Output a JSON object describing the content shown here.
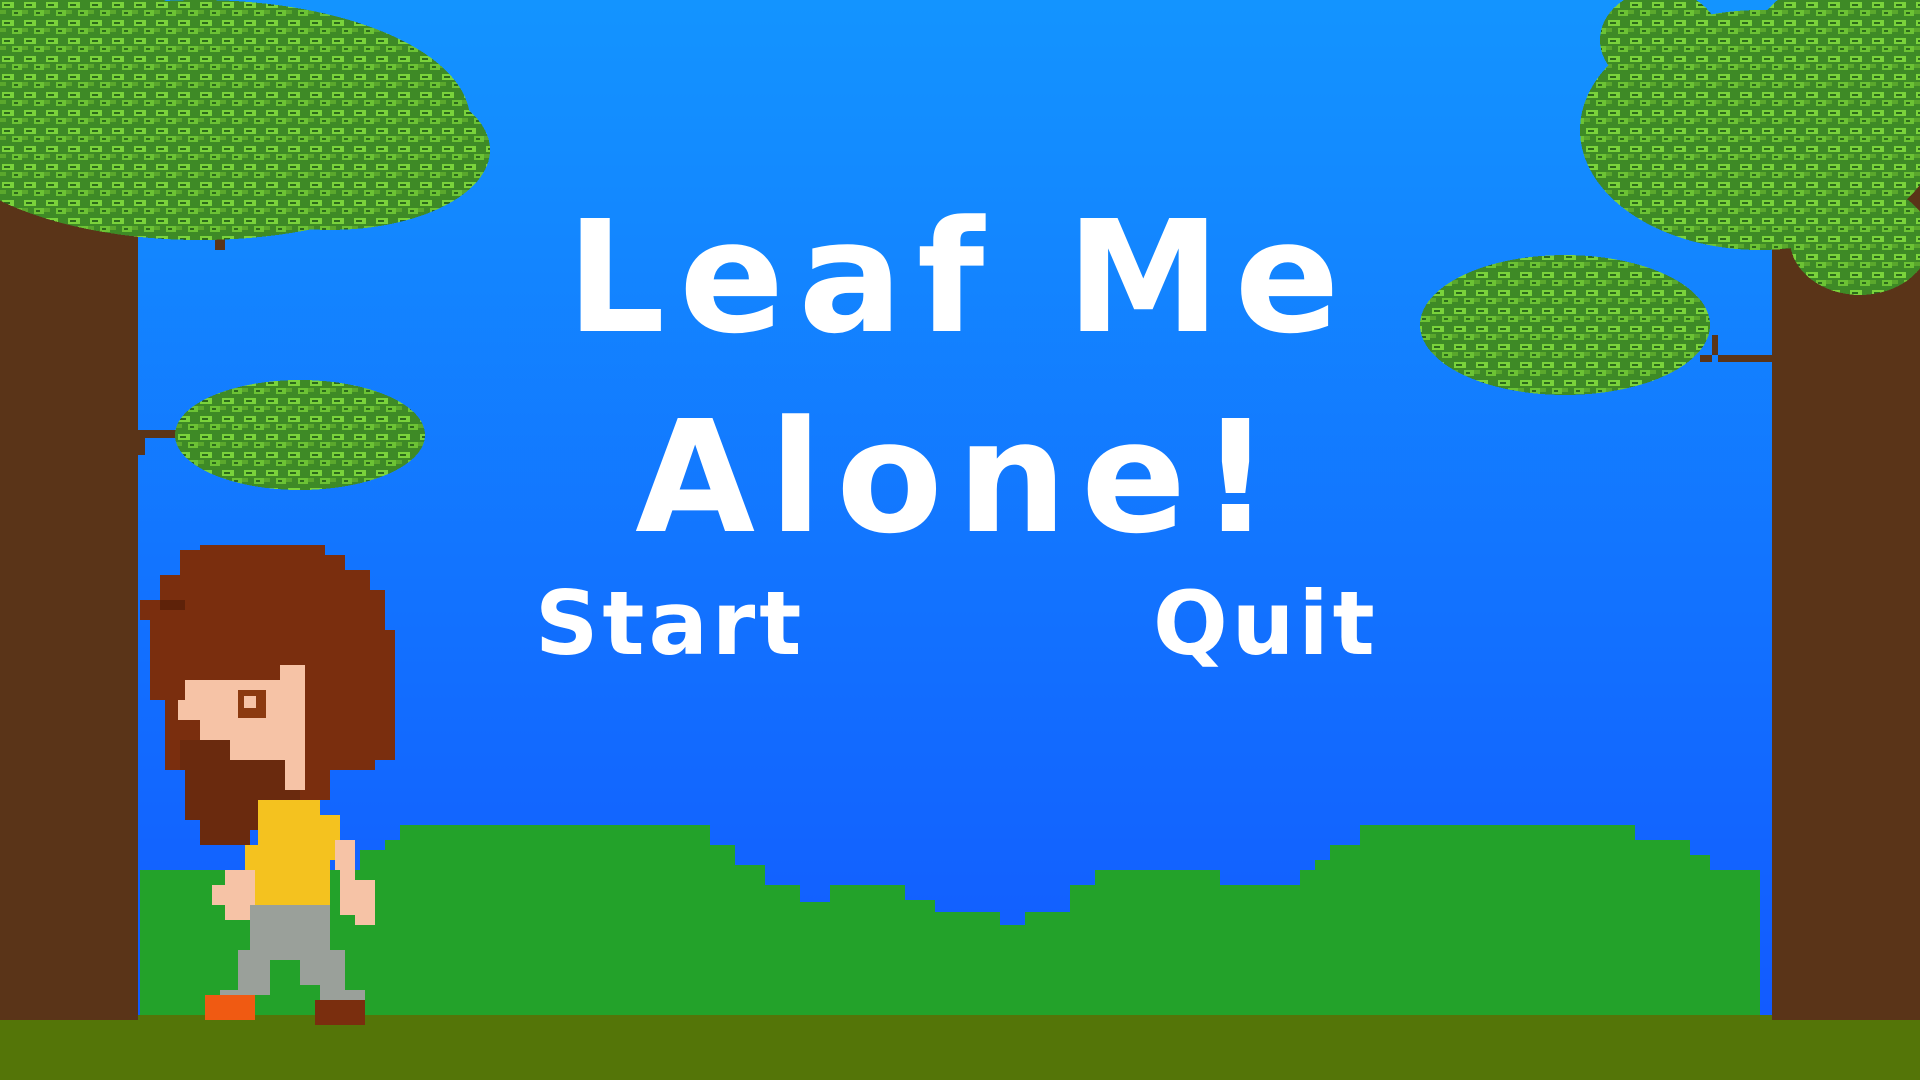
{
  "game": {
    "title_line1": "Leaf Me",
    "title_line2": "Alone!"
  },
  "menu": {
    "start_label": "Start",
    "quit_label": "Quit"
  },
  "colors": {
    "sky_top": "#1394ff",
    "sky_bottom": "#1257ff",
    "hills": "#23a22a",
    "ground": "#547508",
    "trunk": "#5a3418",
    "leaf_dark": "#3a7d22",
    "leaf_light": "#7ad33b",
    "text": "#ffffff"
  }
}
